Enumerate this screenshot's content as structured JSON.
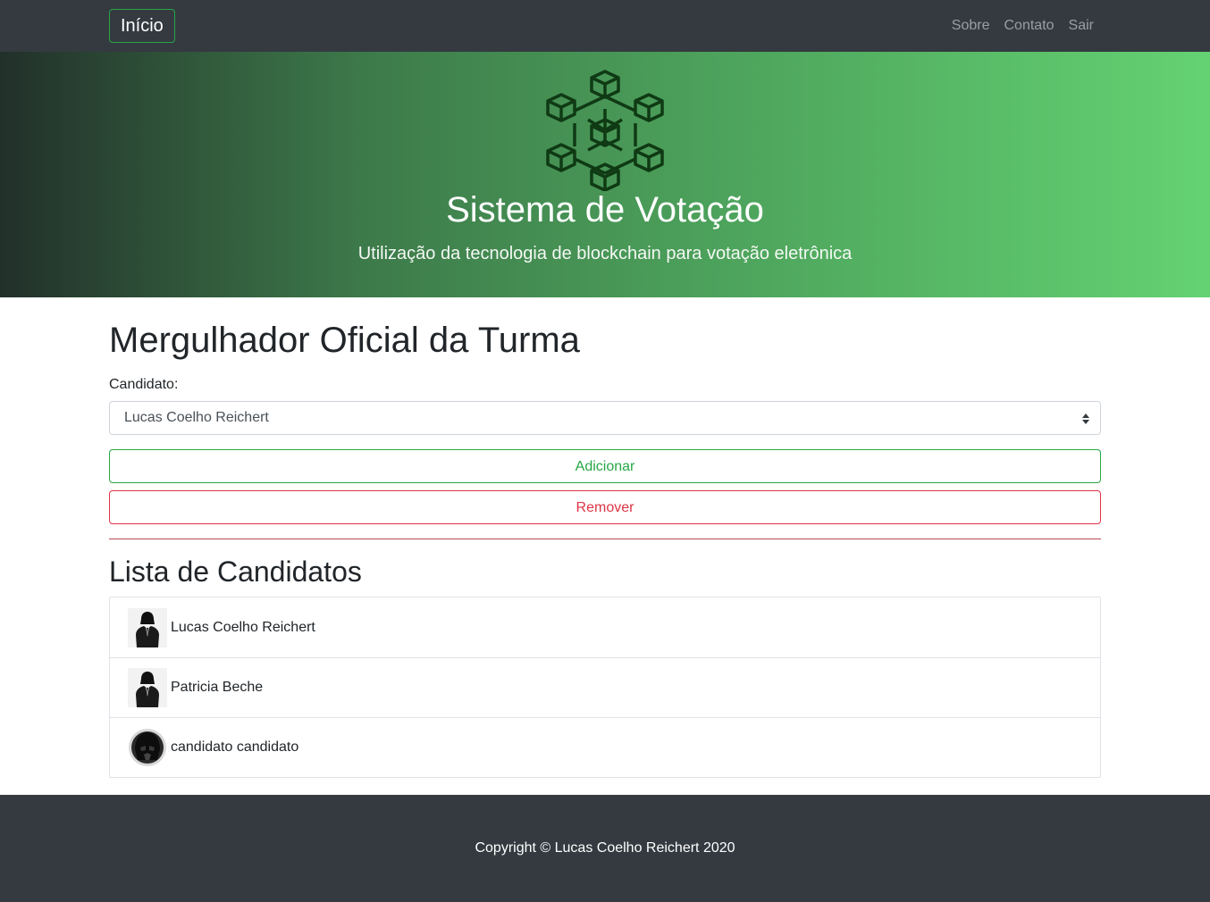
{
  "nav": {
    "brand": "Início",
    "links": [
      "Sobre",
      "Contato",
      "Sair"
    ]
  },
  "hero": {
    "logo_icon": "blockchain-cubes-icon",
    "title": "Sistema de Votação",
    "subtitle": "Utilização da tecnologia de blockchain para votação eletrônica"
  },
  "main": {
    "title": "Mergulhador Oficial da Turma",
    "candidate_label": "Candidato:",
    "candidate_selected": "Lucas Coelho Reichert",
    "add_label": "Adicionar",
    "remove_label": "Remover",
    "list_title": "Lista de Candidatos",
    "candidates": [
      {
        "name": "Lucas Coelho Reichert",
        "avatar": "suit-figure-avatar"
      },
      {
        "name": "Patricia Beche",
        "avatar": "suit-figure-avatar"
      },
      {
        "name": "candidato candidato",
        "avatar": "helmet-avatar"
      }
    ]
  },
  "footer": {
    "copyright": "Copyright © Lucas Coelho Reichert 2020"
  },
  "colors": {
    "navbar_bg": "#343a40",
    "accent_green": "#28a745",
    "danger_red": "#dc3545",
    "hero_gradient_start": "#22302a",
    "hero_gradient_end": "#64d272"
  }
}
